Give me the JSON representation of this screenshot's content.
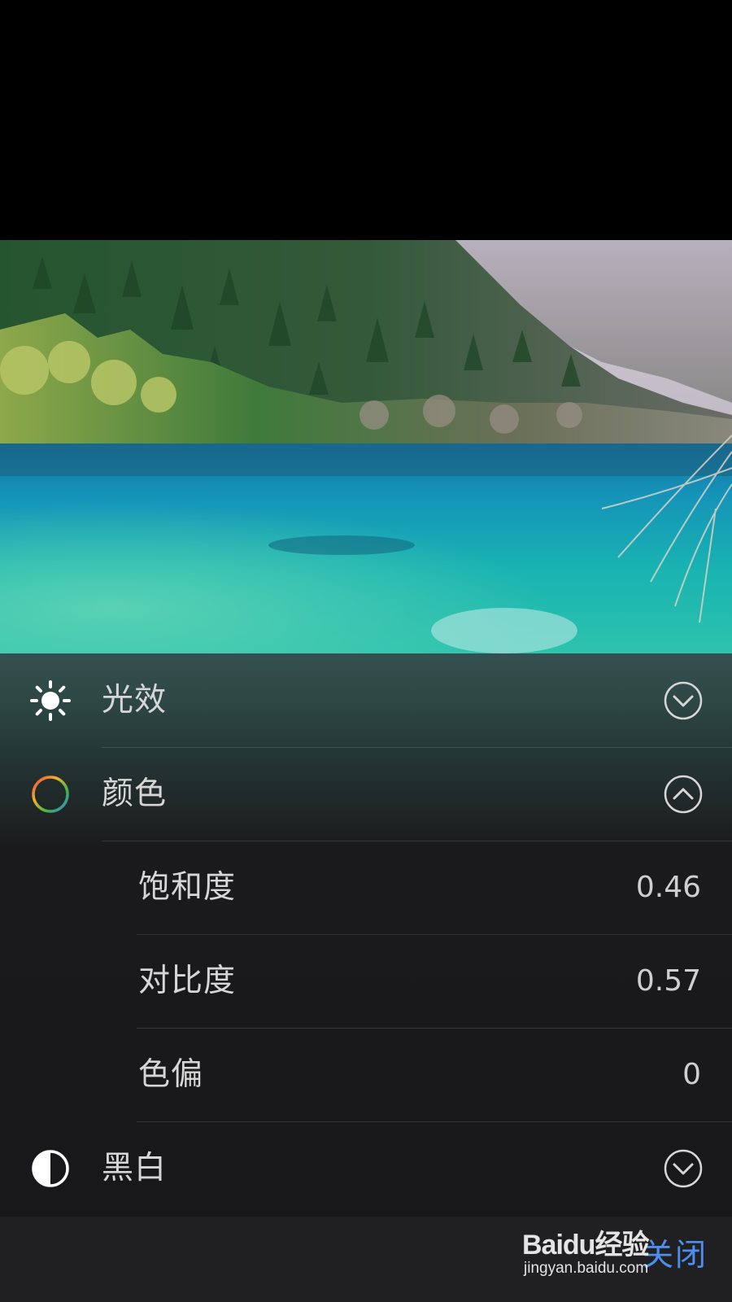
{
  "photo": {
    "alt": "",
    "colors": {
      "sky": "#c9c3cf",
      "forest": "#2d5a35",
      "water": "#17b3b8"
    }
  },
  "panel": {
    "sections": [
      {
        "id": "light",
        "label": "光效",
        "icon": "sun-icon",
        "expanded": false
      },
      {
        "id": "color",
        "label": "颜色",
        "icon": "color-ring-icon",
        "expanded": true,
        "items": [
          {
            "label": "饱和度",
            "value": "0.46"
          },
          {
            "label": "对比度",
            "value": "0.57"
          },
          {
            "label": "色偏",
            "value": "0"
          }
        ]
      },
      {
        "id": "bw",
        "label": "黑白",
        "icon": "half-circle-icon",
        "expanded": false
      }
    ]
  },
  "bottom_bar": {
    "close_label": "关闭"
  },
  "watermark": {
    "brand": "Baidu经验",
    "url": "jingyan.baidu.com"
  },
  "colors": {
    "accent": "#4d8ff0",
    "panel_bg": "#18181a",
    "text": "#d6d6d6"
  }
}
